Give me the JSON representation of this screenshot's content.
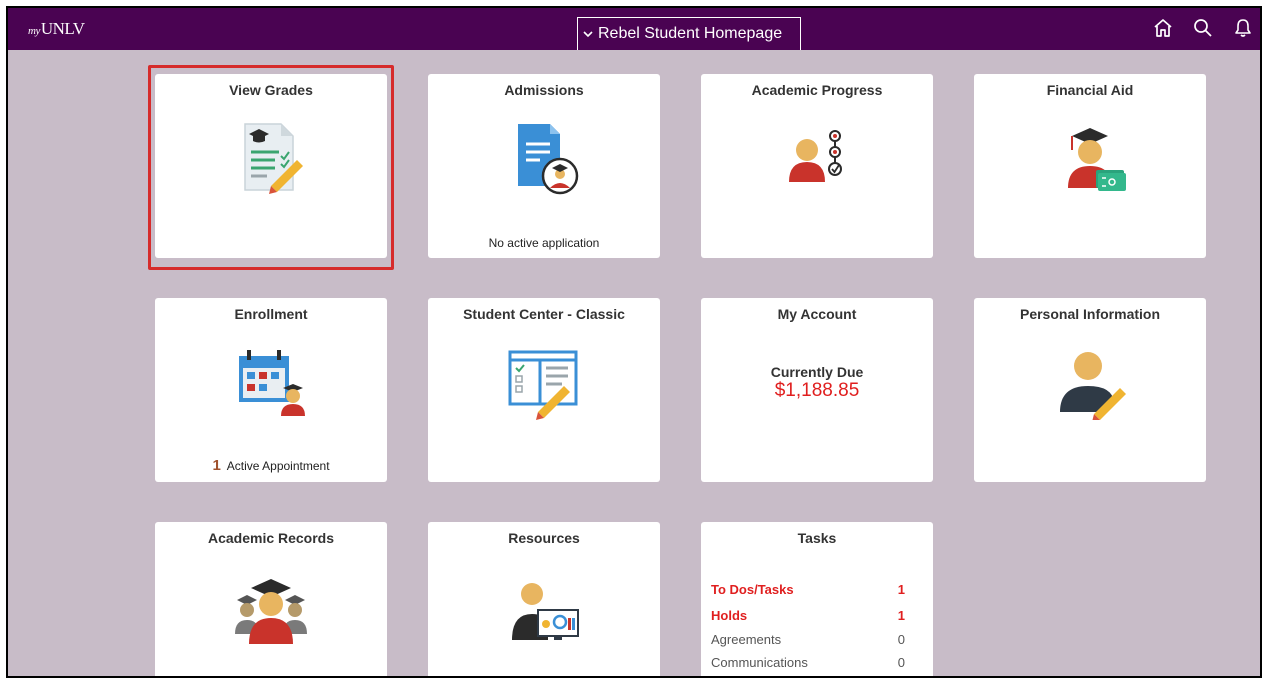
{
  "header": {
    "logo_my": "my",
    "logo_text": "UNLV",
    "page_title": "Rebel Student Homepage",
    "nav_icons": [
      "home-icon",
      "search-icon",
      "bell-icon"
    ]
  },
  "tiles": {
    "view_grades": {
      "title": "View Grades"
    },
    "admissions": {
      "title": "Admissions",
      "sub": "No active application"
    },
    "academic_progress": {
      "title": "Academic Progress"
    },
    "financial_aid": {
      "title": "Financial Aid"
    },
    "enrollment": {
      "title": "Enrollment",
      "count": "1",
      "sub": "Active Appointment"
    },
    "student_center": {
      "title": "Student Center - Classic"
    },
    "my_account": {
      "title": "My Account",
      "due_label": "Currently Due",
      "due_amount": "$1,188.85"
    },
    "personal_information": {
      "title": "Personal Information"
    },
    "academic_records": {
      "title": "Academic Records"
    },
    "resources": {
      "title": "Resources"
    },
    "tasks": {
      "title": "Tasks",
      "rows": [
        {
          "label": "To Dos/Tasks",
          "count": "1",
          "alert": true
        },
        {
          "label": "Holds",
          "count": "1",
          "alert": true
        },
        {
          "label": "Agreements",
          "count": "0",
          "alert": false
        },
        {
          "label": "Communications",
          "count": "0",
          "alert": false
        }
      ]
    }
  },
  "colors": {
    "header_bg": "#4a0352",
    "page_bg": "#c8bcc8",
    "highlight": "#d62b2b",
    "alert_text": "#e01f1f"
  }
}
